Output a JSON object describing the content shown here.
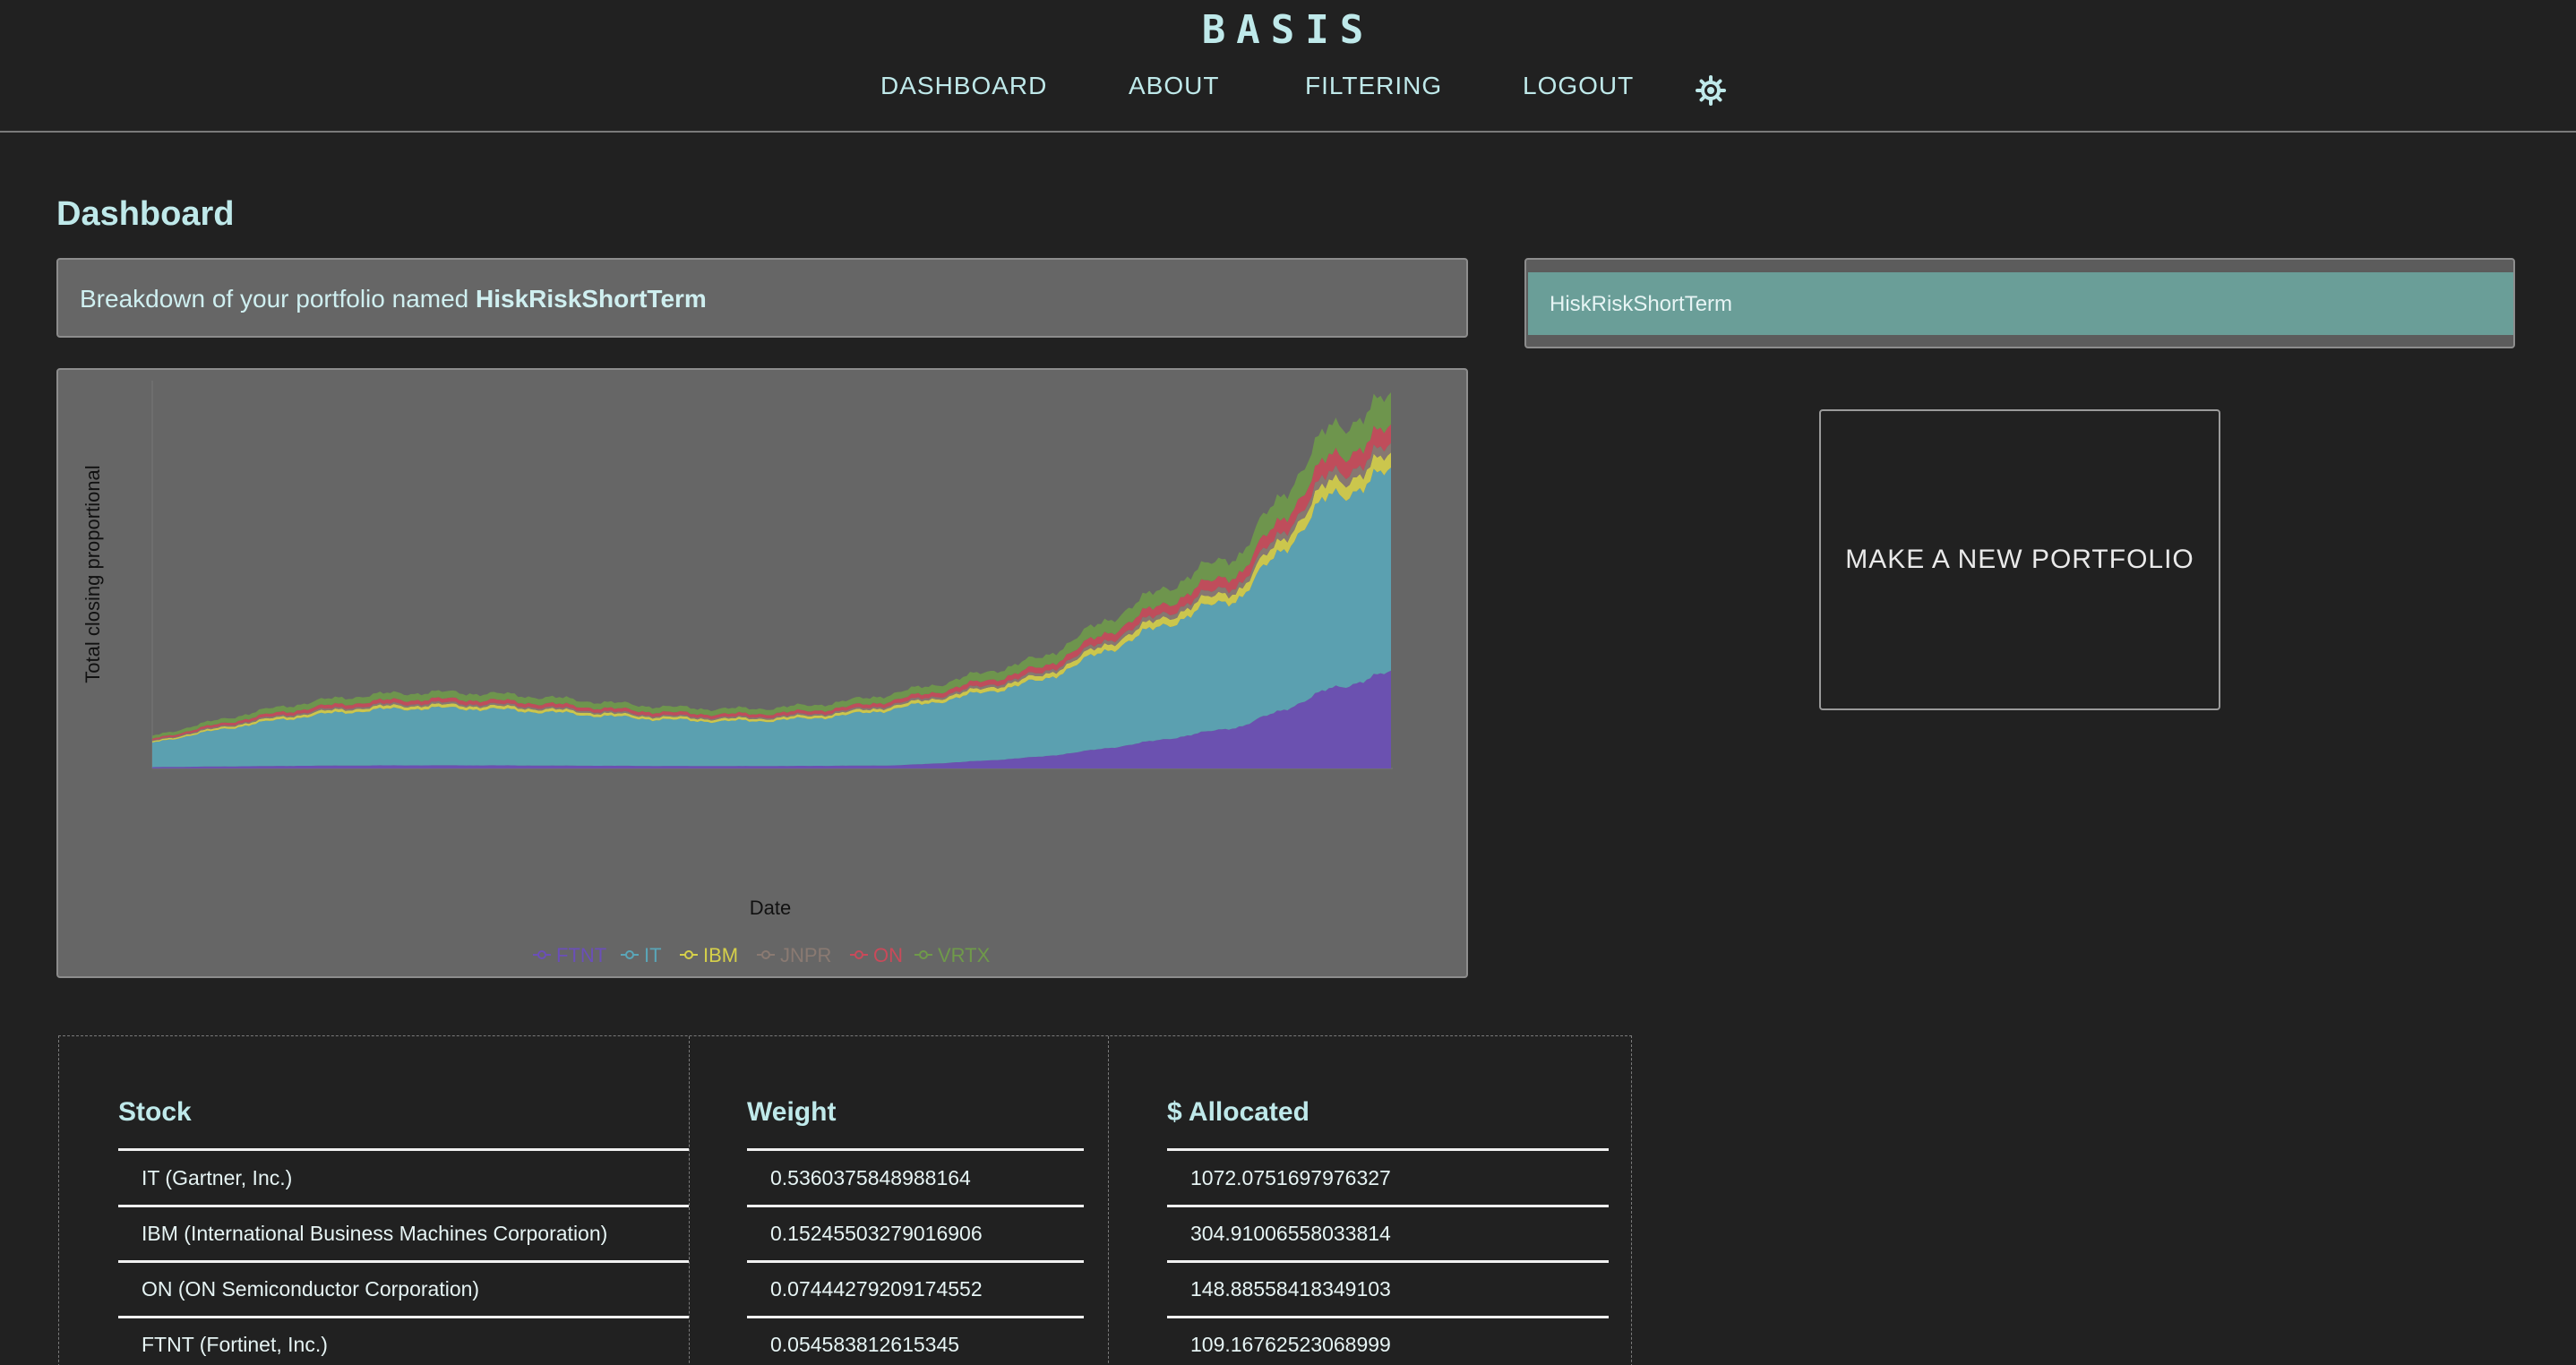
{
  "header": {
    "logo": "BASIS",
    "nav": [
      "DASHBOARD",
      "ABOUT",
      "FILTERING",
      "LOGOUT"
    ],
    "theme_icon": "sun-gear-icon"
  },
  "page": {
    "title": "Dashboard",
    "breakdown_prefix": "Breakdown of your portfolio named",
    "portfolio_name": "HiskRiskShortTerm"
  },
  "sidebar": {
    "portfolios": [
      "HiskRiskShortTerm"
    ],
    "new_portfolio_label": "MAKE A NEW PORTFOLIO"
  },
  "chart_data": {
    "type": "area",
    "ylabel": "Total closing proportional",
    "xlabel": "Date",
    "stacked": true,
    "legend_position": "bottom",
    "legend": [
      "FTNT",
      "IT",
      "IBM",
      "JNPR",
      "ON",
      "VRTX"
    ],
    "colors": {
      "FTNT": "#6b4fb8",
      "IT": "#5aa6b8",
      "IBM": "#d6d04a",
      "JNPR": "#8a7a72",
      "ON": "#c94a5a",
      "VRTX": "#6f9a4a"
    }
  },
  "table": {
    "headers": [
      "Stock",
      "Weight",
      "$ Allocated"
    ],
    "rows": [
      {
        "stock": "IT (Gartner, Inc.)",
        "weight": "0.5360375848988164",
        "allocated": "1072.0751697976327"
      },
      {
        "stock": "IBM (International Business Machines Corporation)",
        "weight": "0.15245503279016906",
        "allocated": "304.91006558033814"
      },
      {
        "stock": "ON (ON Semiconductor Corporation)",
        "weight": "0.07444279209174552",
        "allocated": "148.88558418349103"
      },
      {
        "stock": "FTNT (Fortinet, Inc.)",
        "weight": "0.054583812615345",
        "allocated": "109.16762523068999"
      }
    ]
  }
}
